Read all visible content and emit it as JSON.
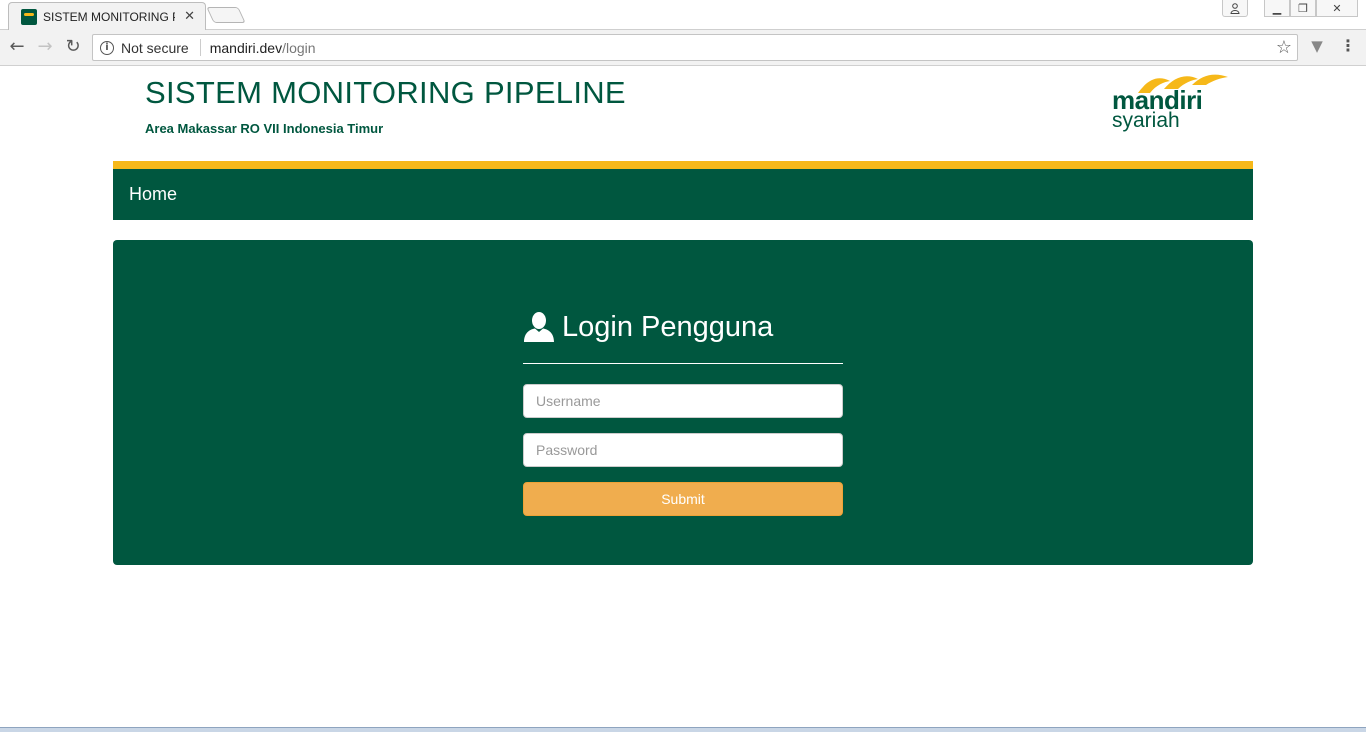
{
  "browser": {
    "tab_title": "SISTEM MONITORING PIPELINE",
    "tab_close": "✕",
    "security_label": "Not secure",
    "url_host": "mandiri.dev",
    "url_path": "/login",
    "icons": {
      "back": "←",
      "forward": "→",
      "reload": "↻",
      "info": "i",
      "star": "☆",
      "extension": "▼",
      "menu": "⋮",
      "minimize": "▁",
      "restore": "❐",
      "close": "✕",
      "user": "👤"
    }
  },
  "header": {
    "title": "SISTEM MONITORING PIPELINE",
    "subtitle": "Area Makassar RO VII Indonesia Timur",
    "logo_main": "mandiri",
    "logo_sub": "syariah"
  },
  "nav": {
    "home_label": "Home"
  },
  "login": {
    "heading": "Login Pengguna",
    "username_placeholder": "Username",
    "password_placeholder": "Password",
    "submit_label": "Submit"
  },
  "colors": {
    "brand_green": "#00573f",
    "brand_gold": "#f6b819",
    "submit_orange": "#f0ad4e"
  }
}
